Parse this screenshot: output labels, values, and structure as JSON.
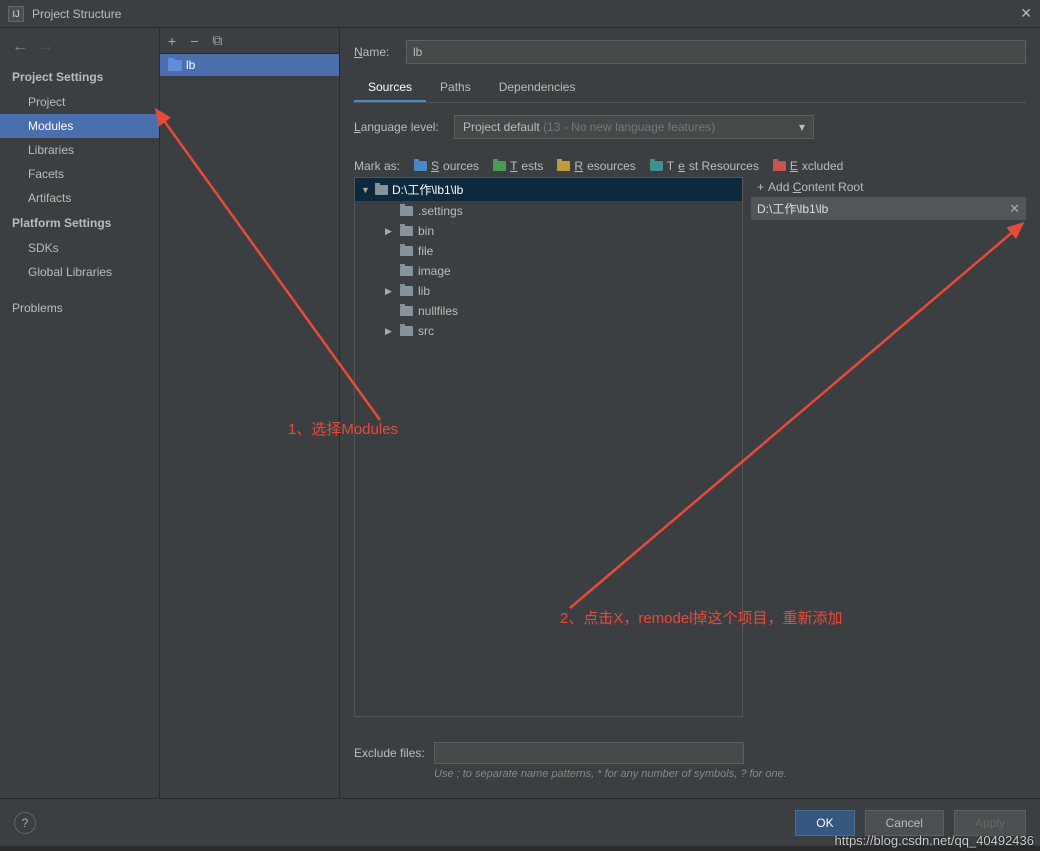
{
  "window": {
    "title": "Project Structure"
  },
  "sidebar": {
    "project_settings_header": "Project Settings",
    "platform_settings_header": "Platform Settings",
    "items": {
      "project": "Project",
      "modules": "Modules",
      "libraries": "Libraries",
      "facets": "Facets",
      "artifacts": "Artifacts",
      "sdks": "SDKs",
      "global_libraries": "Global Libraries",
      "problems": "Problems"
    }
  },
  "module_list": {
    "selected": "lb"
  },
  "content": {
    "name_label": "Name:",
    "name_value": "lb",
    "tabs": {
      "sources": "Sources",
      "paths": "Paths",
      "dependencies": "Dependencies"
    },
    "lang_level_label": "Language level:",
    "lang_level_value": "Project default",
    "lang_level_hint": "(13 - No new language features)",
    "mark_as_label": "Mark as:",
    "marks": {
      "sources": "Sources",
      "tests": "Tests",
      "resources": "Resources",
      "test_resources": "Test Resources",
      "excluded": "Excluded"
    },
    "tree": {
      "root": "D:\\工作\\lb1\\lb",
      "children": [
        {
          "name": ".settings",
          "expandable": false
        },
        {
          "name": "bin",
          "expandable": true
        },
        {
          "name": "file",
          "expandable": false
        },
        {
          "name": "image",
          "expandable": false
        },
        {
          "name": "lib",
          "expandable": true
        },
        {
          "name": "nullfiles",
          "expandable": false
        },
        {
          "name": "src",
          "expandable": true
        }
      ]
    },
    "add_content_root": "Add Content Root",
    "content_root_path": "D:\\工作\\lb1\\lb",
    "exclude_label": "Exclude files:",
    "exclude_hint": "Use ; to separate name patterns, * for any number of symbols, ? for one."
  },
  "footer": {
    "ok": "OK",
    "cancel": "Cancel",
    "apply": "Apply"
  },
  "annotations": {
    "step1": "1、选择Modules",
    "step2": "2、点击X，remodel掉这个项目，重新添加"
  },
  "watermark": "https://blog.csdn.net/qq_40492436"
}
